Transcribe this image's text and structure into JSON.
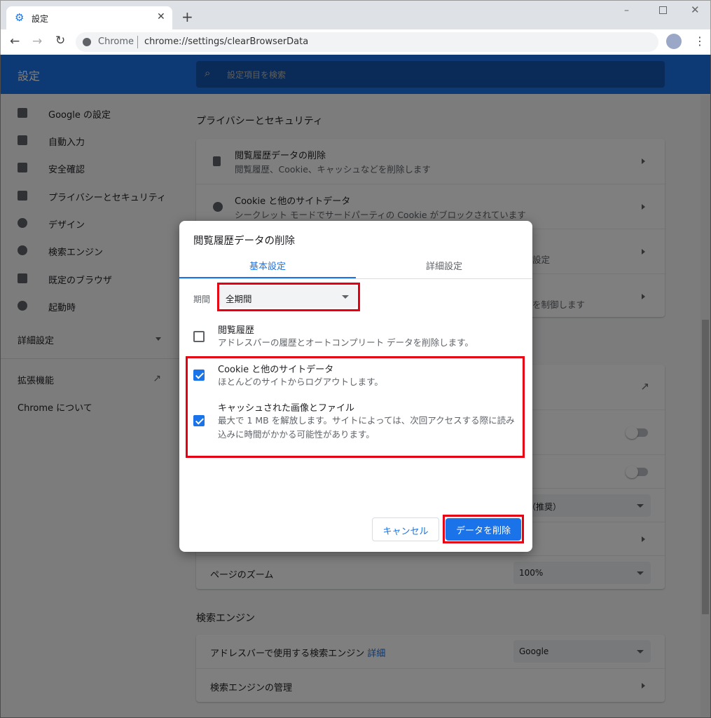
{
  "browser": {
    "tab_title": "設定",
    "omnibox_site": "Chrome",
    "url": "chrome://settings/clearBrowserData"
  },
  "header": {
    "title": "設定",
    "search_placeholder": "設定項目を検索"
  },
  "sidebar": {
    "items": [
      {
        "label": "Google の設定",
        "icon": "person-icon"
      },
      {
        "label": "自動入力",
        "icon": "clipboard-icon"
      },
      {
        "label": "安全確認",
        "icon": "shield-check-icon"
      },
      {
        "label": "プライバシーとセキュリティ",
        "icon": "shield-icon"
      },
      {
        "label": "デザイン",
        "icon": "palette-icon"
      },
      {
        "label": "検索エンジン",
        "icon": "search-icon"
      },
      {
        "label": "既定のブラウザ",
        "icon": "browser-icon"
      },
      {
        "label": "起動時",
        "icon": "power-icon"
      }
    ],
    "advanced": "詳細設定",
    "extensions": "拡張機能",
    "about": "Chrome について"
  },
  "privacy": {
    "title": "プライバシーとセキュリティ",
    "rows": [
      {
        "title": "閲覧履歴データの削除",
        "desc": "閲覧履歴、Cookie、キャッシュなどを削除します"
      },
      {
        "title": "Cookie と他のサイトデータ",
        "desc": "シークレット モードでサードパーティの Cookie がブロックされています"
      },
      {
        "desc": "設定"
      },
      {
        "desc": "を制御します"
      }
    ]
  },
  "appearance": {
    "dropdown_partial": "（推奨）",
    "zoom_label": "ページのズーム",
    "zoom_value": "100%"
  },
  "search_engine": {
    "title": "検索エンジン",
    "row1": "アドレスバーで使用する検索エンジン",
    "row1_link": "詳細",
    "row1_value": "Google",
    "row2": "検索エンジンの管理"
  },
  "dialog": {
    "title": "閲覧履歴データの削除",
    "tabs": [
      {
        "label": "基本設定",
        "active": true
      },
      {
        "label": "詳細設定",
        "active": false
      }
    ],
    "period_label": "期間",
    "period_value": "全期間",
    "options": [
      {
        "title": "閲覧履歴",
        "desc": "アドレスバーの履歴とオートコンプリート データを削除します。",
        "checked": false
      },
      {
        "title": "Cookie と他のサイトデータ",
        "desc": "ほとんどのサイトからログアウトします。",
        "checked": true
      },
      {
        "title": "キャッシュされた画像とファイル",
        "desc": "最大で 1 MB を解放します。サイトによっては、次回アクセスする際に読み込みに時間がかかる可能性があります。",
        "checked": true
      }
    ],
    "cancel": "キャンセル",
    "confirm": "データを削除"
  },
  "colors": {
    "accent": "#1a73e8",
    "highlight": "#e60012"
  }
}
